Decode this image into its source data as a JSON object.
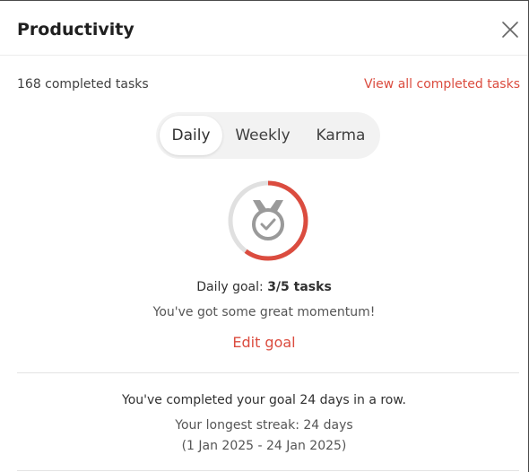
{
  "dialog": {
    "title": "Productivity",
    "close_icon": "close-icon"
  },
  "summary": {
    "completed_count": "168 completed tasks",
    "view_all_label": "View all completed tasks"
  },
  "tabs": [
    {
      "label": "Daily",
      "selected": true
    },
    {
      "label": "Weekly",
      "selected": false
    },
    {
      "label": "Karma",
      "selected": false
    }
  ],
  "goal": {
    "icon": "medal-check-icon",
    "prefix": "Daily goal: ",
    "value": "3/5 tasks",
    "completed": 3,
    "target": 5,
    "message": "You've got some great momentum!",
    "edit_label": "Edit goal"
  },
  "streak": {
    "current": "You've completed your goal 24 days in a row.",
    "longest": "Your longest streak: 24 days",
    "range": "(1 Jan 2025 - 24 Jan 2025)"
  },
  "colors": {
    "accent": "#db4c3f",
    "ring_track": "#e0e0e0",
    "icon_gray": "#9a9a9a"
  }
}
